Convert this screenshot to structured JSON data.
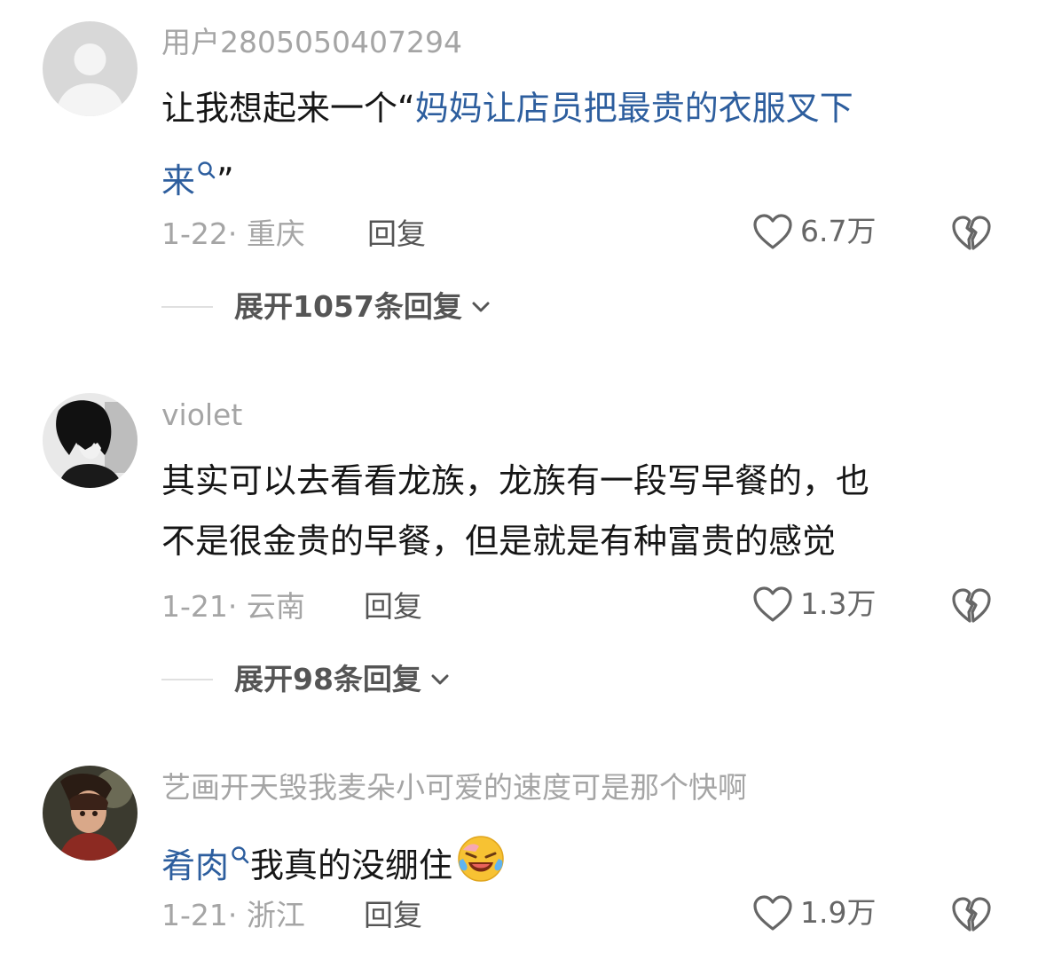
{
  "comments": [
    {
      "username": "用户2805050407294",
      "text_plain": "让我想起来一个“",
      "text_link_1": "妈妈让店员把最贵的衣服叉下",
      "text_link_2": "来",
      "text_end": "”",
      "date": "1-22",
      "location": "重庆",
      "reply_label": "回复",
      "likes": "6.7万",
      "expand_label": "展开1057条回复"
    },
    {
      "username": "violet",
      "text_line_1": "其实可以去看看龙族，龙族有一段写早餐的，也",
      "text_line_2": "不是很金贵的早餐，但是就是有种富贵的感觉",
      "date": "1-21",
      "location": "云南",
      "reply_label": "回复",
      "likes": "1.3万",
      "expand_label": "展开98条回复"
    },
    {
      "username": "艺画开天毁我麦朵小可爱的速度可是那个快啊",
      "text_link": "肴肉",
      "text_plain": "我真的没绷住",
      "date": "1-21",
      "location": "浙江",
      "reply_label": "回复",
      "likes": "1.9万"
    }
  ],
  "icons": {
    "like": "heart-outline-icon",
    "dislike": "broken-heart-icon",
    "expand": "chevron-down-icon",
    "search": "search-icon",
    "emoji": "laughing-crying-emoji"
  },
  "colors": {
    "link": "#2d5e9e",
    "meta": "#a5a5a5",
    "text": "#161616"
  }
}
